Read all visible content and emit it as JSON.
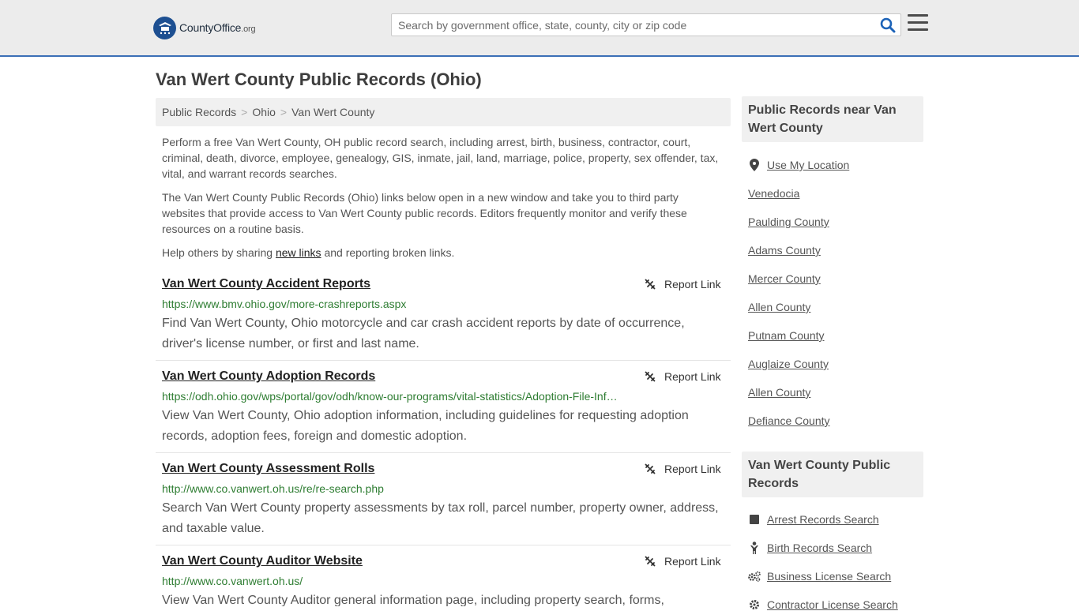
{
  "header": {
    "logo_text": "CountyOffice",
    "logo_suffix": ".org",
    "search_placeholder": "Search by government office, state, county, city or zip code"
  },
  "page_title": "Van Wert County Public Records (Ohio)",
  "breadcrumb": [
    "Public Records",
    "Ohio",
    "Van Wert County"
  ],
  "intro": {
    "p1": "Perform a free Van Wert County, OH public record search, including arrest, birth, business, contractor, court, criminal, death, divorce, employee, genealogy, GIS, inmate, jail, land, marriage, police, property, sex offender, tax, vital, and warrant records searches.",
    "p2": "The Van Wert County Public Records (Ohio) links below open in a new window and take you to third party websites that provide access to Van Wert County public records. Editors frequently monitor and verify these resources on a routine basis.",
    "p3_before": "Help others by sharing ",
    "p3_link": "new links",
    "p3_after": " and reporting broken links."
  },
  "report_label": "Report Link",
  "results": [
    {
      "title": "Van Wert County Accident Reports",
      "url": "https://www.bmv.ohio.gov/more-crashreports.aspx",
      "desc": "Find Van Wert County, Ohio motorcycle and car crash accident reports by date of occurrence, driver's license number, or first and last name."
    },
    {
      "title": "Van Wert County Adoption Records",
      "url": "https://odh.ohio.gov/wps/portal/gov/odh/know-our-programs/vital-statistics/Adoption-File-Inf…",
      "desc": "View Van Wert County, Ohio adoption information, including guidelines for requesting adoption records, adoption fees, foreign and domestic adoption."
    },
    {
      "title": "Van Wert County Assessment Rolls",
      "url": "http://www.co.vanwert.oh.us/re/re-search.php",
      "desc": "Search Van Wert County property assessments by tax roll, parcel number, property owner, address, and taxable value."
    },
    {
      "title": "Van Wert County Auditor Website",
      "url": "http://www.co.vanwert.oh.us/",
      "desc": "View Van Wert County Auditor general information page, including property search, forms,"
    }
  ],
  "sidebar": {
    "near_title": "Public Records near Van Wert County",
    "use_location": "Use My Location",
    "near_links": [
      "Venedocia",
      "Paulding County",
      "Adams County",
      "Mercer County",
      "Allen County",
      "Putnam County",
      "Auglaize County",
      "Allen County",
      "Defiance County"
    ],
    "records_title": "Van Wert County Public Records",
    "record_links": [
      {
        "label": "Arrest Records Search",
        "icon": "square-icon"
      },
      {
        "label": "Birth Records Search",
        "icon": "child-icon"
      },
      {
        "label": "Business License Search",
        "icon": "gears-icon"
      },
      {
        "label": "Contractor License Search",
        "icon": "gear-icon"
      }
    ]
  },
  "colors": {
    "header_bg": "#ececec",
    "header_border": "#3b6fb6",
    "url_green": "#2e7d32",
    "search_icon": "#1d63b8"
  }
}
